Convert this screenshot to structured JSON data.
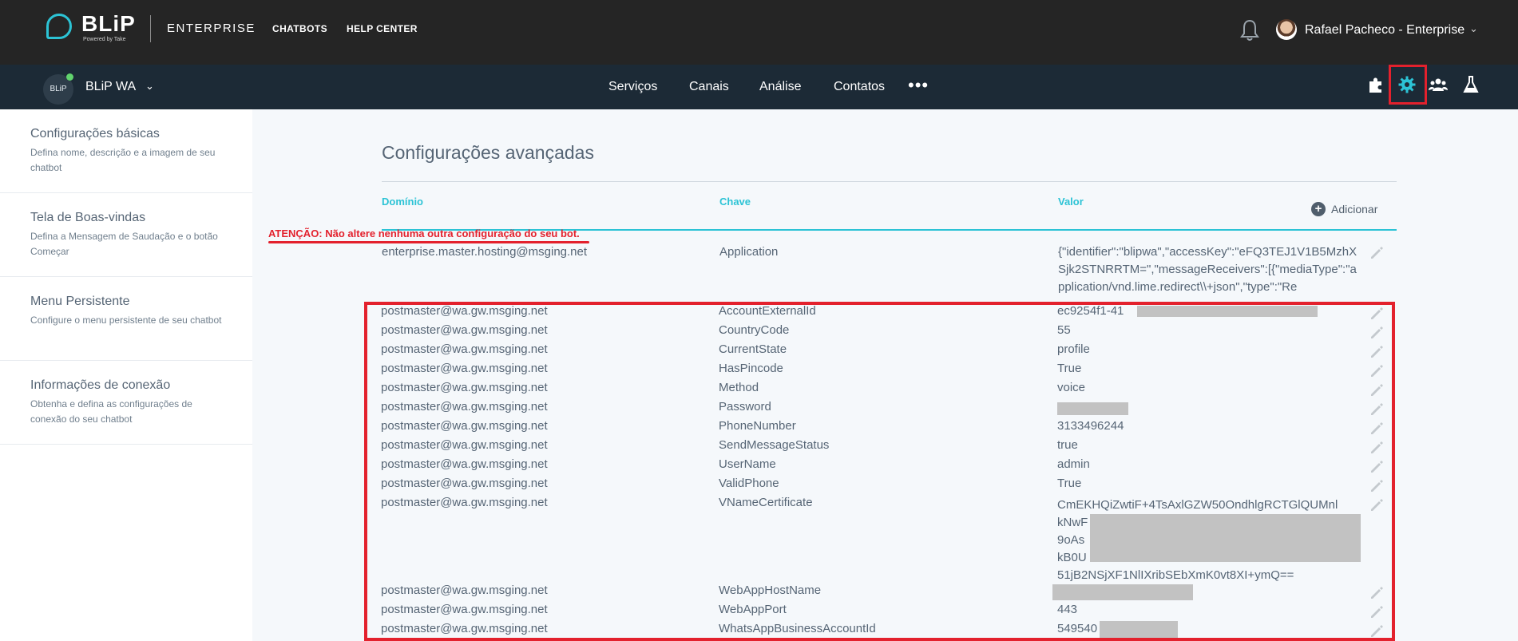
{
  "topbar": {
    "brand": "BLiP",
    "brand_sub": "Powered by Take",
    "product": "ENTERPRISE",
    "nav": [
      "CHATBOTS",
      "HELP CENTER"
    ],
    "user_name": "Rafael Pacheco - Enterprise"
  },
  "subbar": {
    "bot_avatar_text": "BLiP",
    "bot_name": "BLiP WA",
    "nav": [
      "Serviços",
      "Canais",
      "Análise",
      "Contatos"
    ],
    "more": "•••",
    "tools": [
      "puzzle-icon",
      "gear-icon",
      "users-icon",
      "flask-icon"
    ]
  },
  "sidebar": {
    "items": [
      {
        "title": "Configurações básicas",
        "desc": "Defina nome, descrição e a imagem de seu chatbot"
      },
      {
        "title": "Tela de Boas-vindas",
        "desc": "Defina a Mensagem de Saudação e o botão Começar"
      },
      {
        "title": "Menu Persistente",
        "desc": "Configure o menu persistente de seu chatbot"
      },
      {
        "title": "Informações de conexão",
        "desc": "Obtenha e defina as configurações de conexão do seu chatbot"
      }
    ]
  },
  "main": {
    "title": "Configurações avançadas",
    "columns": {
      "domain": "Domínio",
      "key": "Chave",
      "value": "Valor"
    },
    "add_label": "Adicionar",
    "warning": "ATENÇÃO: Não altere nenhuma outra configuração do seu bot.",
    "first_row": {
      "domain": "enterprise.master.hosting@msging.net",
      "key": "Application",
      "value": "{\"identifier\":\"blipwa\",\"accessKey\":\"eFQ3TEJ1V1B5MzhXSjk2STNRRTM=\",\"messageReceivers\":[{\"mediaType\":\"application/vnd.lime.redirect\\\\+json\",\"type\":\"Re"
    },
    "rows": [
      {
        "domain": "postmaster@wa.gw.msging.net",
        "key": "AccountExternalId",
        "value": "ec9254f1-41"
      },
      {
        "domain": "postmaster@wa.gw.msging.net",
        "key": "CountryCode",
        "value": "55"
      },
      {
        "domain": "postmaster@wa.gw.msging.net",
        "key": "CurrentState",
        "value": "profile"
      },
      {
        "domain": "postmaster@wa.gw.msging.net",
        "key": "HasPincode",
        "value": "True"
      },
      {
        "domain": "postmaster@wa.gw.msging.net",
        "key": "Method",
        "value": "voice"
      },
      {
        "domain": "postmaster@wa.gw.msging.net",
        "key": "Password",
        "value": ""
      },
      {
        "domain": "postmaster@wa.gw.msging.net",
        "key": "PhoneNumber",
        "value": "3133496244"
      },
      {
        "domain": "postmaster@wa.gw.msging.net",
        "key": "SendMessageStatus",
        "value": "true"
      },
      {
        "domain": "postmaster@wa.gw.msging.net",
        "key": "UserName",
        "value": "admin"
      },
      {
        "domain": "postmaster@wa.gw.msging.net",
        "key": "ValidPhone",
        "value": "True"
      },
      {
        "domain": "postmaster@wa.gw.msging.net",
        "key": "VNameCertificate",
        "value": ""
      },
      {
        "domain": "postmaster@wa.gw.msging.net",
        "key": "WebAppHostName",
        "value": ""
      },
      {
        "domain": "postmaster@wa.gw.msging.net",
        "key": "WebAppPort",
        "value": "443"
      },
      {
        "domain": "postmaster@wa.gw.msging.net",
        "key": "WhatsAppBusinessAccountId",
        "value": "549540"
      }
    ],
    "cert_lines": [
      "CmEKHQiZwtiF+4TsAxlGZW50OndhlgRCTGlQUMnl",
      "kNwF",
      "9oAs",
      "kB0U",
      "51jB2NSjXF1NlIXribSEbXmK0vt8XI+ymQ=="
    ]
  },
  "colors": {
    "accent": "#2cc3d5",
    "alert": "#e3212d",
    "topbar": "#252525",
    "subbar": "#1c2a36"
  }
}
